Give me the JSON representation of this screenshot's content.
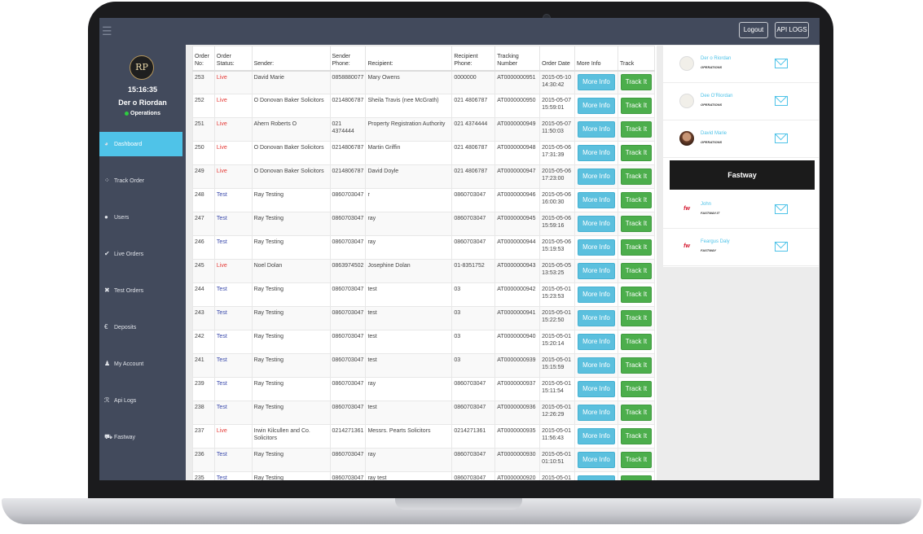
{
  "topbar": {
    "menu_icon": "hamburger-icon",
    "logout_label": "Logout",
    "api_logs_label": "API LOGS"
  },
  "sidebar": {
    "logo_text": "RP",
    "clock": "15:16:35",
    "user_name": "Der o Riordan",
    "user_role": "Operations",
    "items": [
      {
        "label": "Dashboard",
        "icon": "dashboard-icon"
      },
      {
        "label": "Track Order",
        "icon": "spinner-icon"
      },
      {
        "label": "Users",
        "icon": "user-icon"
      },
      {
        "label": "Live Orders",
        "icon": "check-icon"
      },
      {
        "label": "Test Orders",
        "icon": "x-icon"
      },
      {
        "label": "Deposits",
        "icon": "euro-icon"
      },
      {
        "label": "My Account",
        "icon": "person-icon"
      },
      {
        "label": "Api Logs",
        "icon": "rss-icon"
      },
      {
        "label": "Fastway",
        "icon": "truck-icon"
      }
    ]
  },
  "table": {
    "headers": [
      "Order No:",
      "Order Status:",
      "Sender:",
      "Sender Phone:",
      "Recipient:",
      "Recipient Phone:",
      "Tracking Number",
      "Order Date",
      "More Info",
      "Track"
    ],
    "more_info_label": "More Info",
    "track_label": "Track It",
    "rows": [
      {
        "order_no": "253",
        "status": "Live",
        "sender": "David Marie",
        "sender_phone": "0858880077",
        "recipient": "Mary Owens",
        "recipient_phone": "0000000",
        "tracking": "AT0000000951",
        "date": "2015-05-10 14:30:42"
      },
      {
        "order_no": "252",
        "status": "Live",
        "sender": "O Donovan Baker Solicitors",
        "sender_phone": "0214806787",
        "recipient": "Sheila Travis (nee McGrath)",
        "recipient_phone": "021 4806787",
        "tracking": "AT0000000950",
        "date": "2015-05-07 15:59:01"
      },
      {
        "order_no": "251",
        "status": "Live",
        "sender": "Ahern Roberts O",
        "sender_phone": "021 4374444",
        "recipient": "Property Registration Authority",
        "recipient_phone": "021 4374444",
        "tracking": "AT0000000949",
        "date": "2015-05-07 11:50:03"
      },
      {
        "order_no": "250",
        "status": "Live",
        "sender": "O Donovan Baker Solicitors",
        "sender_phone": "0214806787",
        "recipient": "Martin Griffin",
        "recipient_phone": "021 4806787",
        "tracking": "AT0000000948",
        "date": "2015-05-06 17:31:39"
      },
      {
        "order_no": "249",
        "status": "Live",
        "sender": "O Donovan Baker Solicitors",
        "sender_phone": "0214806787",
        "recipient": "David Doyle",
        "recipient_phone": "021 4806787",
        "tracking": "AT0000000947",
        "date": "2015-05-06 17:23:00"
      },
      {
        "order_no": "248",
        "status": "Test",
        "sender": "Ray Testing",
        "sender_phone": "0860703047",
        "recipient": "r",
        "recipient_phone": "0860703047",
        "tracking": "AT0000000946",
        "date": "2015-05-06 16:00:30"
      },
      {
        "order_no": "247",
        "status": "Test",
        "sender": "Ray Testing",
        "sender_phone": "0860703047",
        "recipient": "ray",
        "recipient_phone": "0860703047",
        "tracking": "AT0000000945",
        "date": "2015-05-06 15:59:16"
      },
      {
        "order_no": "246",
        "status": "Test",
        "sender": "Ray Testing",
        "sender_phone": "0860703047",
        "recipient": "ray",
        "recipient_phone": "0860703047",
        "tracking": "AT0000000944",
        "date": "2015-05-06 15:19:53"
      },
      {
        "order_no": "245",
        "status": "Live",
        "sender": "Noel Dolan",
        "sender_phone": "0863974502",
        "recipient": "Josephine Dolan",
        "recipient_phone": "01-8351752",
        "tracking": "AT0000000943",
        "date": "2015-05-05 13:53:25"
      },
      {
        "order_no": "244",
        "status": "Test",
        "sender": "Ray Testing",
        "sender_phone": "0860703047",
        "recipient": "test",
        "recipient_phone": "03",
        "tracking": "AT0000000942",
        "date": "2015-05-01 15:23:53"
      },
      {
        "order_no": "243",
        "status": "Test",
        "sender": "Ray Testing",
        "sender_phone": "0860703047",
        "recipient": "test",
        "recipient_phone": "03",
        "tracking": "AT0000000941",
        "date": "2015-05-01 15:22:50"
      },
      {
        "order_no": "242",
        "status": "Test",
        "sender": "Ray Testing",
        "sender_phone": "0860703047",
        "recipient": "test",
        "recipient_phone": "03",
        "tracking": "AT0000000940",
        "date": "2015-05-01 15:20:14"
      },
      {
        "order_no": "241",
        "status": "Test",
        "sender": "Ray Testing",
        "sender_phone": "0860703047",
        "recipient": "test",
        "recipient_phone": "03",
        "tracking": "AT0000000939",
        "date": "2015-05-01 15:15:59"
      },
      {
        "order_no": "239",
        "status": "Test",
        "sender": "Ray Testing",
        "sender_phone": "0860703047",
        "recipient": "ray",
        "recipient_phone": "0860703047",
        "tracking": "AT0000000937",
        "date": "2015-05-01 15:11:54"
      },
      {
        "order_no": "238",
        "status": "Test",
        "sender": "Ray Testing",
        "sender_phone": "0860703047",
        "recipient": "test",
        "recipient_phone": "0860703047",
        "tracking": "AT0000000936",
        "date": "2015-05-01 12:26:29"
      },
      {
        "order_no": "237",
        "status": "Live",
        "sender": "Irwin Kilcullen and Co. Solicitors",
        "sender_phone": "0214271361",
        "recipient": "Messrs. Pearts Solicitors",
        "recipient_phone": "0214271361",
        "tracking": "AT0000000935",
        "date": "2015-05-01 11:56:43"
      },
      {
        "order_no": "236",
        "status": "Test",
        "sender": "Ray Testing",
        "sender_phone": "0860703047",
        "recipient": "ray",
        "recipient_phone": "0860703047",
        "tracking": "AT0000000930",
        "date": "2015-05-01 01:10:51"
      },
      {
        "order_no": "235",
        "status": "Test",
        "sender": "Ray Testing",
        "sender_phone": "0860703047",
        "recipient": "ray test",
        "recipient_phone": "0860703047",
        "tracking": "AT0000000920",
        "date": "2015-05-01"
      }
    ]
  },
  "contacts_top": [
    {
      "name": "Der o Riordan",
      "role": "OPERATIONS",
      "avatar": "logo"
    },
    {
      "name": "Dee O'Riordan",
      "role": "OPERATIONS",
      "avatar": "logo"
    },
    {
      "name": "David Marie",
      "role": "OPERATIONS",
      "avatar": "photo"
    }
  ],
  "fastway_banner": "Fastway",
  "contacts_bottom": [
    {
      "name": "John",
      "role": "FASTWAY.IT",
      "avatar": "fastway"
    },
    {
      "name": "Feargus Daly",
      "role": "FASTWAY",
      "avatar": "fastway"
    }
  ],
  "colors": {
    "sidebar": "#424a5c",
    "accent": "#4fc3e8",
    "live": "#e53935",
    "test": "#3949ab",
    "info_button": "#5bc0de",
    "track_button": "#4cae4c"
  }
}
